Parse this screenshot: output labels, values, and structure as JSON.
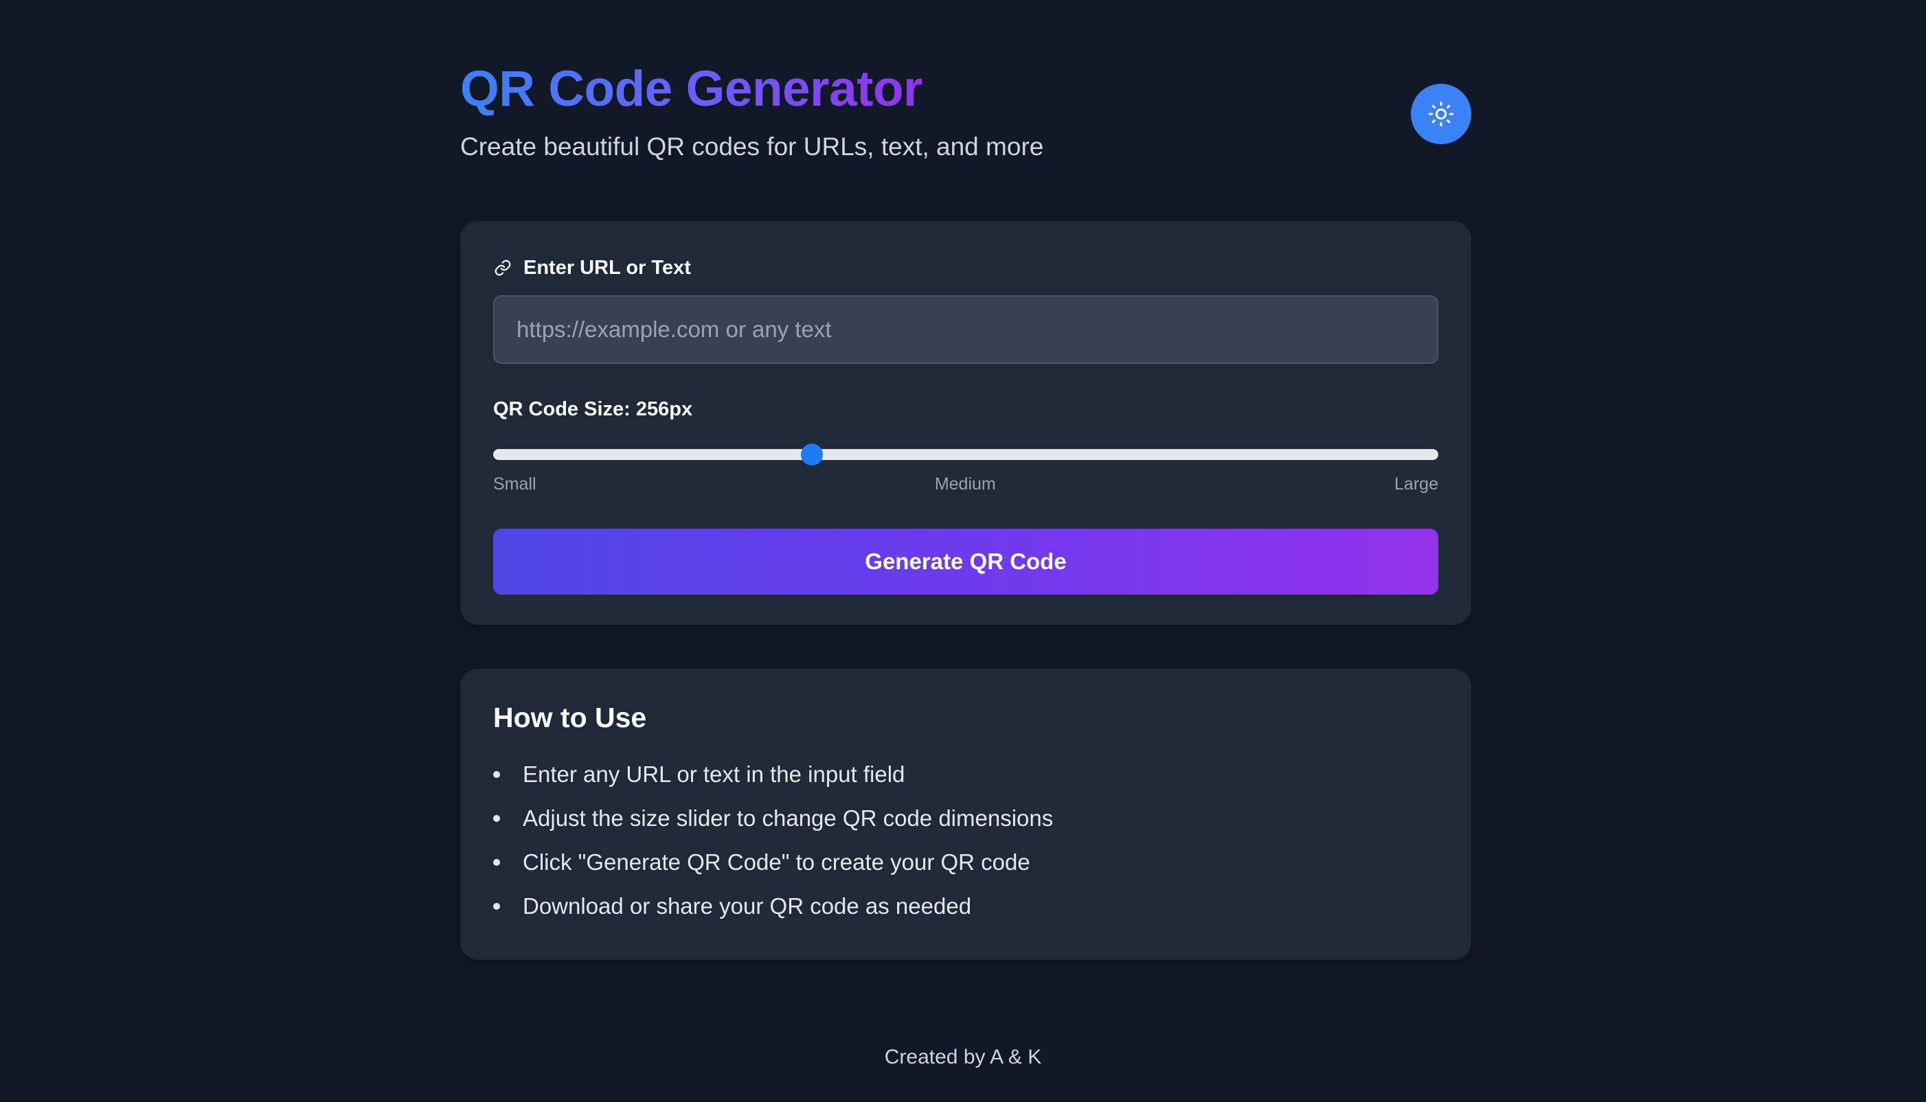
{
  "header": {
    "title": "QR Code Generator",
    "subtitle": "Create beautiful QR codes for URLs, text, and more",
    "theme_toggle_icon": "sun-icon"
  },
  "form": {
    "input_label": "Enter URL or Text",
    "input_icon": "link-icon",
    "input_value": "",
    "input_placeholder": "https://example.com or any text",
    "size_label": "QR Code Size: 256px",
    "slider_level_fraction": 0.337,
    "scale_labels": [
      "Small",
      "Medium",
      "Large"
    ],
    "generate_label": "Generate QR Code"
  },
  "help": {
    "title": "How to Use",
    "items": [
      "Enter any URL or text in the input field",
      "Adjust the size slider to change QR code dimensions",
      "Click \"Generate QR Code\" to create your QR code",
      "Download or share your QR code as needed"
    ]
  },
  "footer": {
    "text": "Created by A & K"
  },
  "colors": {
    "background": "#111827",
    "card": "#1f2937",
    "accent": "#3b82f6",
    "gradient_start": "#4f46e5",
    "gradient_end": "#9333ea"
  }
}
